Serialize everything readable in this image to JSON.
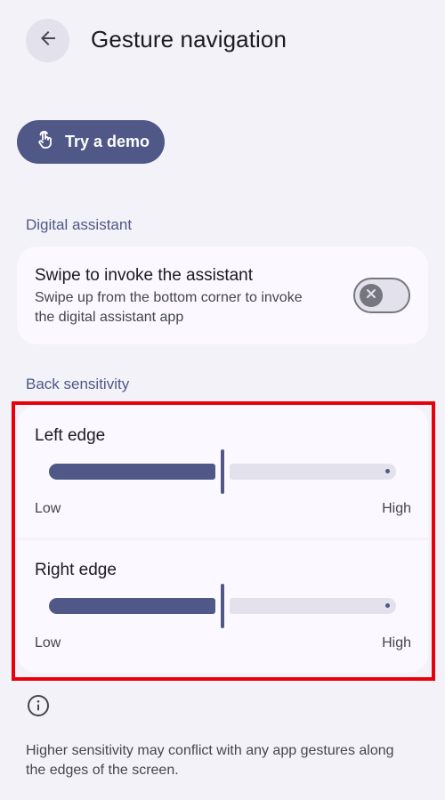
{
  "header": {
    "back_icon": "arrow-back-icon",
    "title": "Gesture navigation"
  },
  "demo": {
    "icon": "touch-gesture-icon",
    "label": "Try a demo"
  },
  "digital_assistant": {
    "section_title": "Digital assistant",
    "item": {
      "title": "Swipe to invoke the assistant",
      "description": "Swipe up from the bottom corner to invoke the digital assistant app",
      "toggle_on": false
    }
  },
  "back_sensitivity": {
    "section_title": "Back sensitivity",
    "sliders": [
      {
        "title": "Left edge",
        "min_label": "Low",
        "max_label": "High",
        "value": 0.5
      },
      {
        "title": "Right edge",
        "min_label": "Low",
        "max_label": "High",
        "value": 0.5
      }
    ]
  },
  "footer": {
    "icon": "info-icon",
    "text": "Higher sensitivity may conflict with any app gestures along the edges of the screen."
  },
  "colors": {
    "background": "#f3f2f9",
    "accent": "#4f5886",
    "card": "#fbf8ff",
    "highlight": "#e8000b"
  }
}
